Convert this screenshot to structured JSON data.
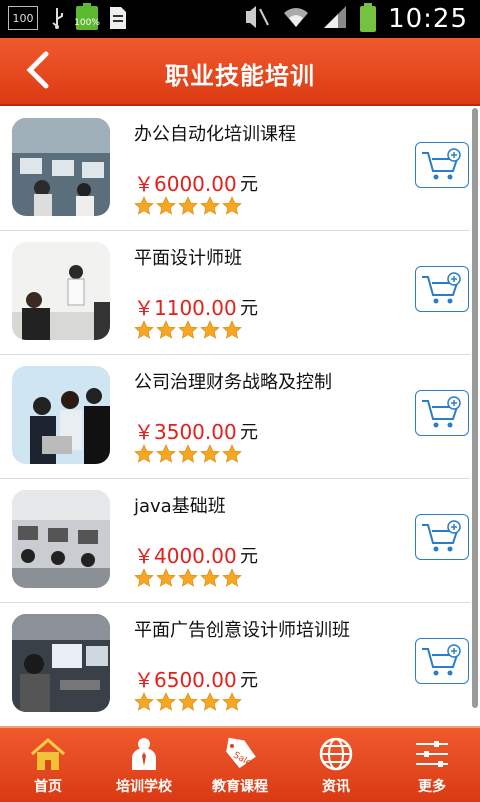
{
  "status_bar": {
    "notif_box": "100",
    "battery_small": "100%",
    "time": "10:25"
  },
  "header": {
    "title": "职业技能培训"
  },
  "courses": [
    {
      "name": "办公自动化培训课程",
      "price": "￥6000.00",
      "unit": "元",
      "rating": 5
    },
    {
      "name": "平面设计师班",
      "price": "￥1100.00",
      "unit": "元",
      "rating": 5
    },
    {
      "name": "公司治理财务战略及控制",
      "price": "￥3500.00",
      "unit": "元",
      "rating": 5
    },
    {
      "name": "java基础班",
      "price": "￥4000.00",
      "unit": "元",
      "rating": 5
    },
    {
      "name": "平面广告创意设计师培训班",
      "price": "￥6500.00",
      "unit": "元",
      "rating": 5
    }
  ],
  "tabs": [
    {
      "label": "首页",
      "icon": "home-icon"
    },
    {
      "label": "培训学校",
      "icon": "teacher-icon"
    },
    {
      "label": "教育课程",
      "icon": "sale-tag-icon"
    },
    {
      "label": "资讯",
      "icon": "globe-icon"
    },
    {
      "label": "更多",
      "icon": "sliders-icon"
    }
  ],
  "colors": {
    "header": "#e8461c",
    "price": "#e3201b",
    "cart_border": "#2a7ec8",
    "star": "#f5a623"
  }
}
